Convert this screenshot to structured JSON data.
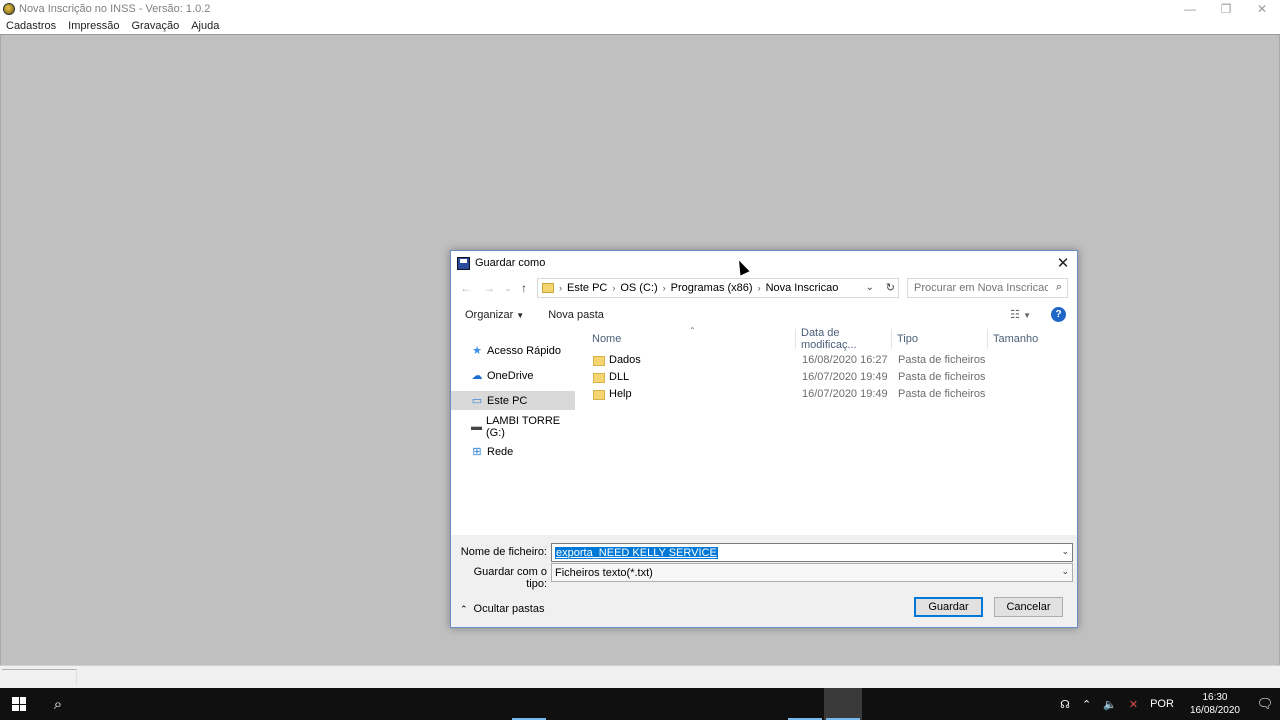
{
  "app": {
    "title": "Nova Inscrição no INSS - Versão: 1.0.2",
    "menu": [
      "Cadastros",
      "Impressão",
      "Gravação",
      "Ajuda"
    ],
    "window_controls": {
      "minimize": "—",
      "restore": "❐",
      "close": "✕"
    }
  },
  "dialog": {
    "title": "Guardar como",
    "close": "✕",
    "nav": {
      "back": "←",
      "forward": "→",
      "recent": "⌄",
      "up": "↑"
    },
    "breadcrumb": [
      "Este PC",
      "OS (C:)",
      "Programas (x86)",
      "Nova Inscricao"
    ],
    "breadcrumb_sep": "›",
    "search_placeholder": "Procurar em Nova Inscricao",
    "toolbar": {
      "organize": "Organizar",
      "new_folder": "Nova pasta",
      "help": "?"
    },
    "nav_pane": [
      {
        "label": "Acesso Rápido",
        "icon": "star-icon",
        "glyph": "★"
      },
      {
        "label": "OneDrive",
        "icon": "cloud-icon",
        "glyph": "☁"
      },
      {
        "label": "Este PC",
        "icon": "computer-icon",
        "glyph": "▭",
        "selected": true
      },
      {
        "label": "LAMBI TORRE (G:)",
        "icon": "drive-icon",
        "glyph": "▬"
      },
      {
        "label": "Rede",
        "icon": "network-icon",
        "glyph": "⊞"
      }
    ],
    "columns": [
      "Nome",
      "Data de modificaç...",
      "Tipo",
      "Tamanho"
    ],
    "files": [
      {
        "name": "Dados",
        "date": "16/08/2020 16:27",
        "type": "Pasta de ficheiros"
      },
      {
        "name": "DLL",
        "date": "16/07/2020 19:49",
        "type": "Pasta de ficheiros"
      },
      {
        "name": "Help",
        "date": "16/07/2020 19:49",
        "type": "Pasta de ficheiros"
      }
    ],
    "filename_label": "Nome de ficheiro:",
    "filename_value": "exporta_NEED KELLY SERVICE",
    "filetype_label": "Guardar com o tipo:",
    "filetype_value": "Ficheiros texto(*.txt)",
    "hide_folders": "Ocultar pastas",
    "save_button": "Guardar",
    "cancel_button": "Cancelar"
  },
  "taskbar": {
    "language": "POR",
    "time": "16:30",
    "date": "16/08/2020"
  },
  "colors": {
    "accent": "#0078d7",
    "taskbar": "#101010",
    "app_background": "#c0c0c0"
  }
}
